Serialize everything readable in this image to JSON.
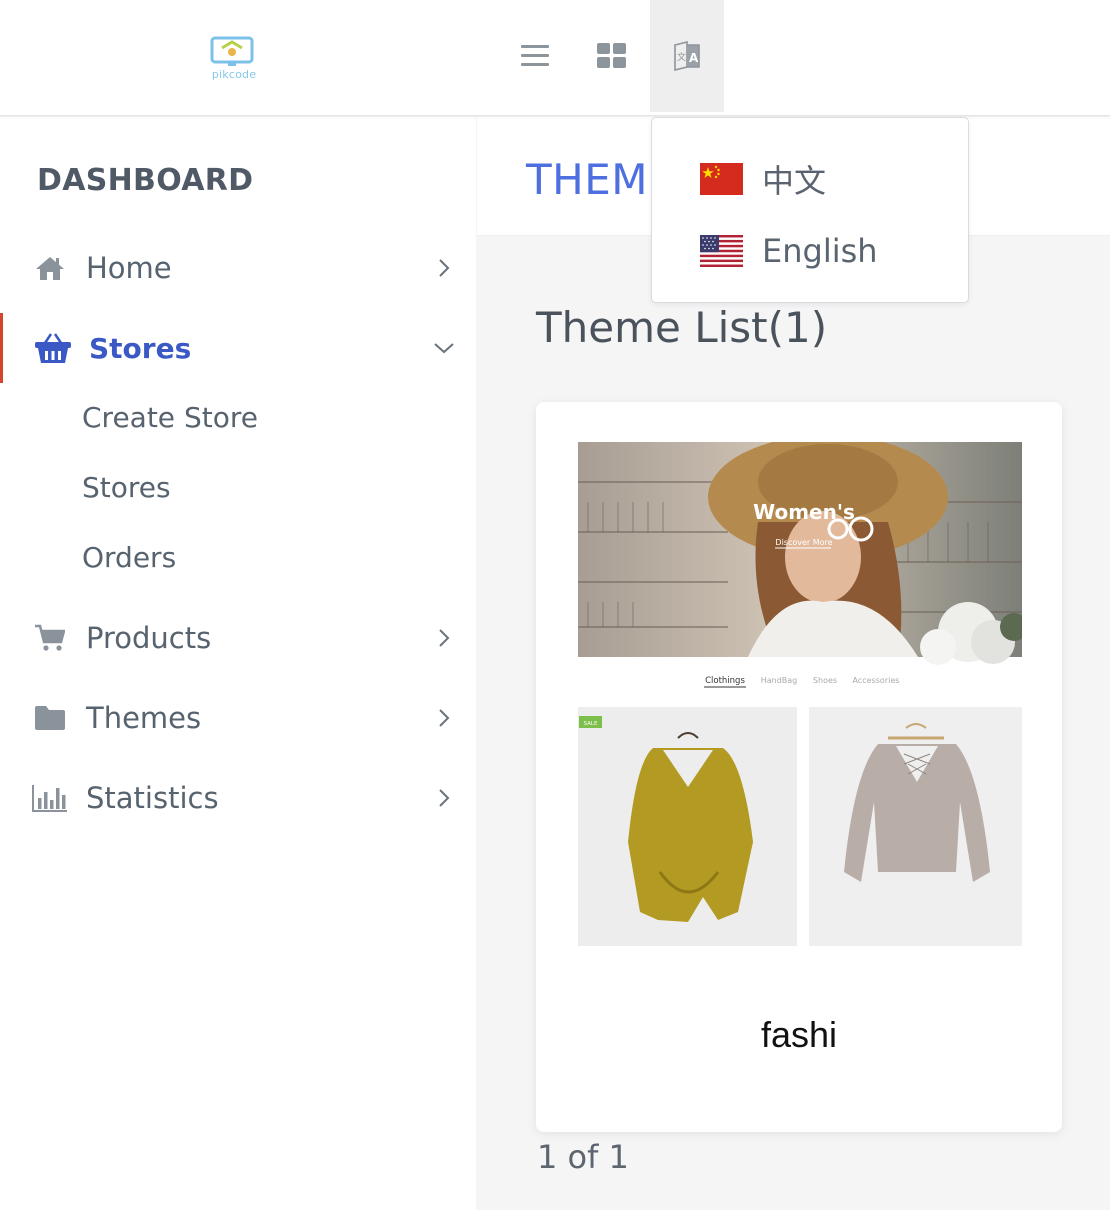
{
  "header": {
    "logo_text": "pikcode",
    "menu_icon": "hamburger-icon",
    "apps_icon": "grid-icon",
    "language_icon": "translate-icon"
  },
  "language_menu": {
    "items": [
      {
        "label": "中文",
        "flag": "china-flag-icon"
      },
      {
        "label": "English",
        "flag": "usa-flag-icon"
      }
    ]
  },
  "sidebar": {
    "title": "DASHBOARD",
    "items": [
      {
        "label": "Home",
        "icon": "home-icon"
      },
      {
        "label": "Stores",
        "icon": "basket-icon",
        "active": true,
        "children": [
          "Create Store",
          "Stores",
          "Orders"
        ]
      },
      {
        "label": "Products",
        "icon": "cart-icon"
      },
      {
        "label": "Themes",
        "icon": "folder-icon"
      },
      {
        "label": "Statistics",
        "icon": "bar-chart-icon"
      }
    ]
  },
  "main": {
    "page_title": "THEMES",
    "list_title": "Theme List(1)",
    "themes": [
      {
        "name": "fashi",
        "preview": {
          "hero_title": "Women's",
          "hero_link": "Discover More",
          "tabs": [
            "Clothings",
            "HandBag",
            "Shoes",
            "Accessories"
          ],
          "badge": "SALE"
        }
      }
    ],
    "pager": "1 of 1"
  },
  "colors": {
    "accent": "#3a59c5",
    "title_blue": "#4d6fe0",
    "active_border": "#d3462d"
  }
}
